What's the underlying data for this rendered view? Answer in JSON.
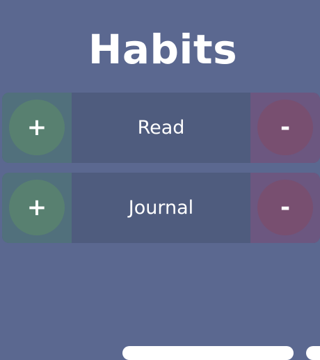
{
  "header": {
    "title": "Habits"
  },
  "habits": [
    {
      "name": "Read",
      "increment_label": "+",
      "decrement_label": "-"
    },
    {
      "name": "Journal",
      "increment_label": "+",
      "decrement_label": "-"
    }
  ],
  "colors": {
    "background": "#5b6890",
    "row": "#4f5c7e",
    "increment_zone": "#51707c",
    "increment_button": "#588070",
    "decrement_zone": "#6c5780",
    "decrement_button": "#784f70"
  }
}
